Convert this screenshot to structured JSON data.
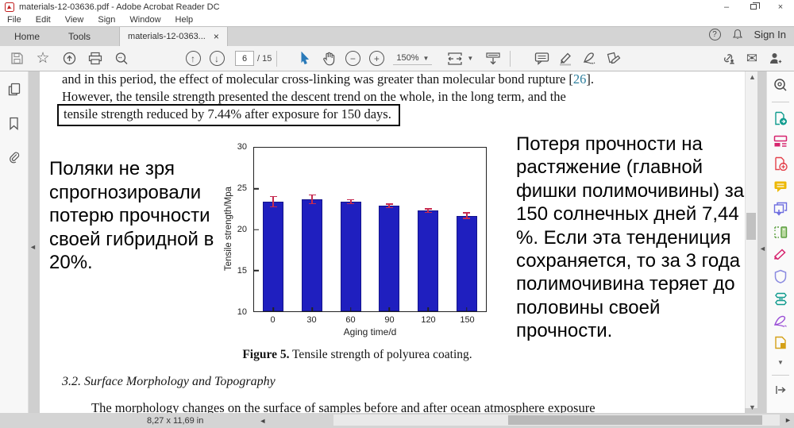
{
  "window": {
    "title": "materials-12-03636.pdf - Adobe Acrobat Reader DC",
    "minimize": "–",
    "close": "×"
  },
  "menu": {
    "items": [
      "File",
      "Edit",
      "View",
      "Sign",
      "Window",
      "Help"
    ]
  },
  "tabs": {
    "home": "Home",
    "tools": "Tools",
    "document": "materials-12-0363...",
    "close": "×"
  },
  "header_right": {
    "help": "?",
    "sign_in": "Sign In"
  },
  "toolbar": {
    "page_current": "6",
    "page_total": "/ 15",
    "zoom_level": "150%",
    "zoom_out": "−",
    "zoom_in": "+",
    "page_up": "↑",
    "page_down": "↓"
  },
  "document": {
    "paragraph_line1_start": "and in this period, the effect of molecular cross-linking was greater than molecular bond rupture [",
    "citation": "26",
    "paragraph_line1_end": "].",
    "paragraph_line2": "However, the tensile strength presented the descent trend on the whole, in the long term, and the",
    "highlighted_sentence": "tensile strength reduced by 7.44% after exposure for 150 days.",
    "left_annotation": "Поляки не зря спрогнозировали потерю прочности своей гибридной в 20%.",
    "right_annotation": "Потеря прочности на растяжение (главной фишки полимочивины) за 150 солнечных дней 7,44 %. Если эта тендениция сохраняется, то за 3 года полимочивина теряет до половины своей прочности.",
    "figure_caption_label": "Figure 5.",
    "figure_caption_text": " Tensile strength of polyurea coating.",
    "section_heading": "3.2. Surface Morphology and Topography",
    "next_paragraph": "The morphology changes on the surface of samples before and after ocean atmosphere exposure"
  },
  "chart_data": {
    "type": "bar",
    "title": "",
    "categories": [
      "0",
      "30",
      "60",
      "90",
      "120",
      "150"
    ],
    "values": [
      23.4,
      23.7,
      23.4,
      22.9,
      22.3,
      21.7
    ],
    "error_bars": [
      0.7,
      0.6,
      0.3,
      0.3,
      0.3,
      0.4
    ],
    "xlabel": "Aging time/d",
    "ylabel": "Tensile strength/Mpa",
    "ylim": [
      10,
      30
    ],
    "yticks": [
      10,
      15,
      20,
      25,
      30
    ],
    "bar_color": "#1f1fbf",
    "error_color": "#c62b50",
    "grid": false,
    "legend": null
  },
  "status_bar": {
    "page_size": "8,27 x 11,69 in"
  },
  "colors": {
    "bar_fill": "#1f1fbf",
    "error_bar": "#c62b50",
    "citation_link": "#2e7f9e",
    "select_tool": "#2a7ab9",
    "highlight_box_border": "#0a0a0a"
  },
  "icons": {
    "pdf-file-icon": "red adobe pdf glyph",
    "save-icon": "floppy disk",
    "star-icon": "☆",
    "share-upload-icon": "cloud up arrow",
    "print-icon": "printer",
    "find-icon": "magnifier",
    "page-up-icon": "circled up arrow",
    "page-down-icon": "circled down arrow",
    "select-tool-icon": "blue cursor arrow",
    "hand-tool-icon": "hand",
    "zoom-out-icon": "circled minus",
    "zoom-in-icon": "circled plus",
    "fit-width-icon": "page with side arrows",
    "reading-mode-icon": "bar with down arrow",
    "comment-icon": "speech bubble",
    "highlight-icon": "highlighter pen",
    "sign-icon": "fountain pen nib",
    "stamp-icon": "document with pencil",
    "share-link-icon": "chain link with person",
    "email-icon": "✉",
    "person-add-icon": "person with plus",
    "bell-icon": "notification bell",
    "page-thumbnails-icon": "stacked pages",
    "bookmarks-icon": "bookmark ribbon",
    "attachments-icon": "paperclip",
    "search-tools-icon": "magnifier Q",
    "export-pdf-icon": "teal page arrow",
    "organize-pages-icon": "magenta page grid",
    "create-pdf-icon": "red page plus",
    "comment-tool-icon": "yellow speech bubble",
    "combine-files-icon": "indigo pages down arrow",
    "scan-ocr-icon": "green scanner",
    "fill-sign-icon": "pink marker",
    "protect-icon": "purple shield",
    "compress-pdf-icon": "teal compress",
    "adobe-sign-icon": "purple quill",
    "more-tools-icon": "yellow page",
    "chevron-down-icon": "⌄",
    "expand-panel-icon": "|→"
  }
}
